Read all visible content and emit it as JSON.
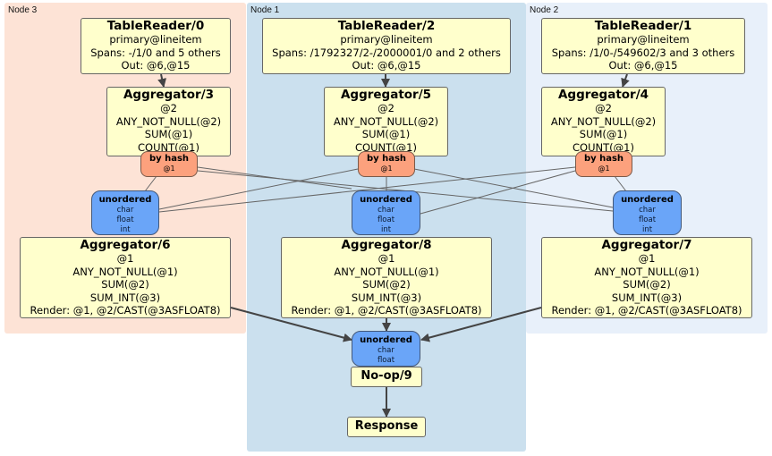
{
  "clusters": [
    {
      "id": "node3",
      "label": "Node 3",
      "color": "#fde3d6"
    },
    {
      "id": "node1",
      "label": "Node 1",
      "color": "#cbe0ee"
    },
    {
      "id": "node2",
      "label": "Node 2",
      "color": "#e8f0fa"
    }
  ],
  "processors": {
    "tr0": {
      "title": "TableReader/0",
      "lines": [
        "primary@lineitem",
        "Spans: -/1/0 and 5 others",
        "Out: @6,@15"
      ]
    },
    "tr2": {
      "title": "TableReader/2",
      "lines": [
        "primary@lineitem",
        "Spans: /1792327/2-/2000001/0 and 2 others",
        "Out: @6,@15"
      ]
    },
    "tr1": {
      "title": "TableReader/1",
      "lines": [
        "primary@lineitem",
        "Spans: /1/0-/549602/3 and 3 others",
        "Out: @6,@15"
      ]
    },
    "agg3": {
      "title": "Aggregator/3",
      "lines": [
        "@2",
        "ANY_NOT_NULL(@2)",
        "SUM(@1)",
        "COUNT(@1)"
      ]
    },
    "agg5": {
      "title": "Aggregator/5",
      "lines": [
        "@2",
        "ANY_NOT_NULL(@2)",
        "SUM(@1)",
        "COUNT(@1)"
      ]
    },
    "agg4": {
      "title": "Aggregator/4",
      "lines": [
        "@2",
        "ANY_NOT_NULL(@2)",
        "SUM(@1)",
        "COUNT(@1)"
      ]
    },
    "agg6": {
      "title": "Aggregator/6",
      "lines": [
        "@1",
        "ANY_NOT_NULL(@1)",
        "SUM(@2)",
        "SUM_INT(@3)",
        "Render: @1, @2/CAST(@3ASFLOAT8)"
      ]
    },
    "agg8": {
      "title": "Aggregator/8",
      "lines": [
        "@1",
        "ANY_NOT_NULL(@1)",
        "SUM(@2)",
        "SUM_INT(@3)",
        "Render: @1, @2/CAST(@3ASFLOAT8)"
      ]
    },
    "agg7": {
      "title": "Aggregator/7",
      "lines": [
        "@1",
        "ANY_NOT_NULL(@1)",
        "SUM(@2)",
        "SUM_INT(@3)",
        "Render: @1, @2/CAST(@3ASFLOAT8)"
      ]
    },
    "noop9": {
      "title": "No-op/9",
      "lines": []
    },
    "response": {
      "title": "Response",
      "lines": []
    }
  },
  "routers": {
    "r3": {
      "title": "by hash",
      "lines": [
        "@1"
      ]
    },
    "r5": {
      "title": "by hash",
      "lines": [
        "@1"
      ]
    },
    "r4": {
      "title": "by hash",
      "lines": [
        "@1"
      ]
    }
  },
  "synchronizers": {
    "s6": {
      "title": "unordered",
      "lines": [
        "char",
        "float",
        "int"
      ]
    },
    "s8": {
      "title": "unordered",
      "lines": [
        "char",
        "float",
        "int"
      ]
    },
    "s7": {
      "title": "unordered",
      "lines": [
        "char",
        "float",
        "int"
      ]
    },
    "s9": {
      "title": "unordered",
      "lines": [
        "char",
        "float"
      ]
    }
  },
  "edge_color": "#444444",
  "stream_color": "#666666"
}
